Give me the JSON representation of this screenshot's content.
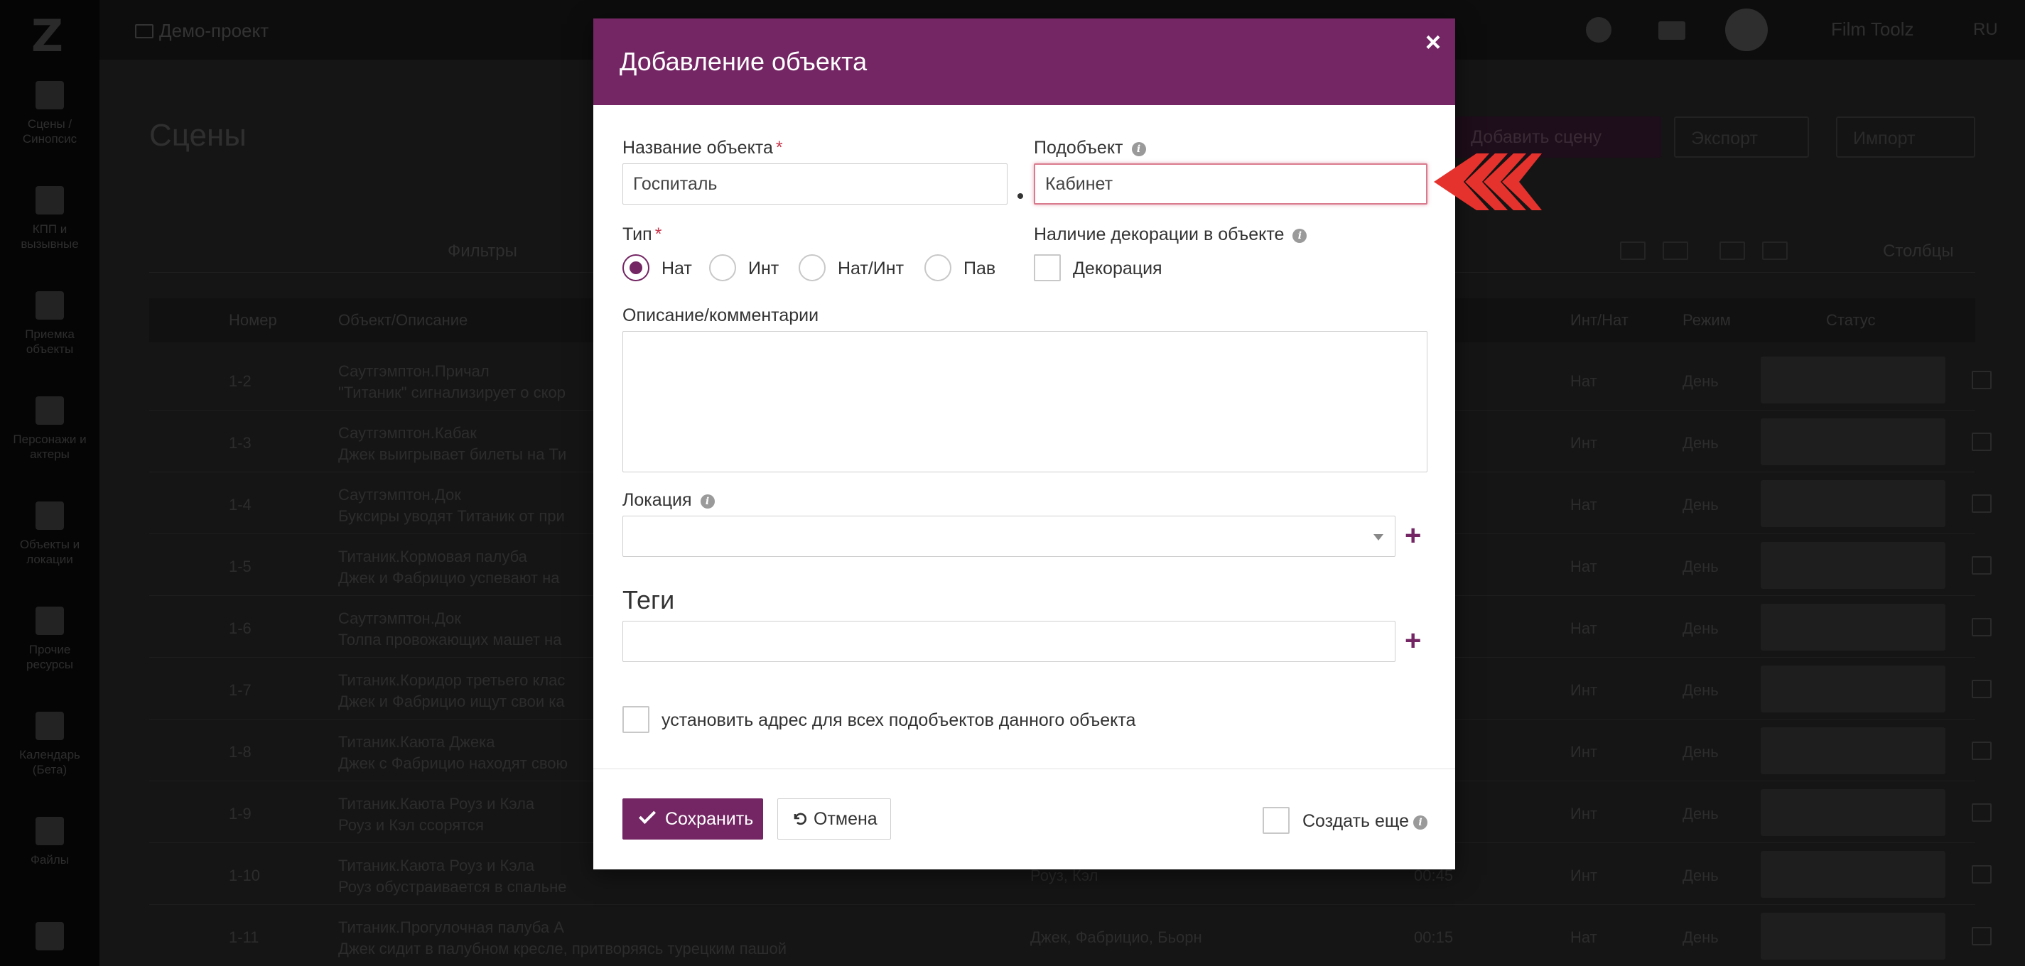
{
  "app": {
    "logo": "Z",
    "project": "Демо-проект",
    "user": "Film Toolz",
    "lang": "RU",
    "sidebar": [
      {
        "label1": "Сцены /",
        "label2": "Синопсис"
      },
      {
        "label1": "КПП и",
        "label2": "вызывные"
      },
      {
        "label1": "Приемка объекты",
        "label2": ""
      },
      {
        "label1": "Персонажи и",
        "label2": "актеры"
      },
      {
        "label1": "Объекты и",
        "label2": "локации"
      },
      {
        "label1": "Прочие",
        "label2": "ресурсы"
      },
      {
        "label1": "Календарь",
        "label2": "(Бета)"
      },
      {
        "label1": "Файлы",
        "label2": ""
      }
    ],
    "page_title": "Сцены",
    "add_scene": "Добавить сцену",
    "export": "Экспорт",
    "import": "Импорт",
    "filters": "Фильтры",
    "columns": "Столбцы",
    "table_headers": {
      "number": "Номер",
      "object": "Объект/Описание",
      "intnat": "Инт/Нат",
      "mode": "Режим",
      "status": "Статус"
    },
    "rows": [
      {
        "num": "1-2",
        "obj": "Саутгэмптон.Причал",
        "desc": "\"Титаник\" сигнализирует о скор",
        "chars": "",
        "dur": "",
        "ie": "Нат",
        "mode": "День"
      },
      {
        "num": "1-3",
        "obj": "Саутгэмптон.Кабак",
        "desc": "Джек выигрывает билеты на Ти",
        "chars": "",
        "dur": "",
        "ie": "Инт",
        "mode": "День"
      },
      {
        "num": "1-4",
        "obj": "Саутгэмптон.Док",
        "desc": "Буксиры уводят Титаник от при",
        "chars": "",
        "dur": "",
        "ie": "Нат",
        "mode": "День"
      },
      {
        "num": "1-5",
        "obj": "Титаник.Кормовая палуба",
        "desc": "Джек и Фабрицио успевают на",
        "chars": "",
        "dur": "",
        "ie": "Нат",
        "mode": "День"
      },
      {
        "num": "1-6",
        "obj": "Саутгэмптон.Док",
        "desc": "Толпа провожающих машет на",
        "chars": "",
        "dur": "",
        "ie": "Нат",
        "mode": "День"
      },
      {
        "num": "1-7",
        "obj": "Титаник.Коридор третьего клас",
        "desc": "Джек и Фабрицио ищут свои ка",
        "chars": "",
        "dur": "",
        "ie": "Инт",
        "mode": "День"
      },
      {
        "num": "1-8",
        "obj": "Титаник.Каюта Джека",
        "desc": "Джек с Фабрицио находят свою",
        "chars": "",
        "dur": "",
        "ie": "Инт",
        "mode": "День"
      },
      {
        "num": "1-9",
        "obj": "Титаник.Каюта Роуз и Кэла",
        "desc": "Роуз и Кэл ссорятся",
        "chars": "",
        "dur": "",
        "ie": "Инт",
        "mode": "День"
      },
      {
        "num": "1-10",
        "obj": "Титаник.Каюта Роуз и Кэла",
        "desc": "Роуз обустраивается в спальне",
        "chars": "Роуз, Кэл",
        "dur": "00:45",
        "ie": "Инт",
        "mode": "День"
      },
      {
        "num": "1-11",
        "obj": "Титаник.Прогулочная палуба А",
        "desc": "Джек сидит в палубном кресле, притворяясь турецким пашой",
        "chars": "Джек, Фабрицио, Бьорн",
        "dur": "00:15",
        "ie": "Нат",
        "mode": "День"
      }
    ]
  },
  "modal": {
    "title": "Добавление объекта",
    "close": "×",
    "object_name_label": "Название объекта",
    "required_mark": "*",
    "object_name_value": "Госпиталь",
    "subobject_label": "Подобъект",
    "subobject_value": "Кабинет",
    "type_label": "Тип",
    "type_options": [
      "Нат",
      "Инт",
      "Нат/Инт",
      "Пав"
    ],
    "type_selected": "Нат",
    "decor_label": "Наличие декорации в объекте",
    "decor_checkbox_label": "Декорация",
    "description_label": "Описание/комментарии",
    "location_label": "Локация",
    "tags_title": "Теги",
    "address_all_label": "установить адрес для всех подобъектов данного объекта",
    "save_label": "Сохранить",
    "cancel_label": "Отмена",
    "create_more_label": "Создать еще",
    "info_glyph": "i",
    "plus_glyph": "+"
  },
  "colors": {
    "accent": "#732663",
    "required": "#c8364b",
    "arrow": "#e5322d"
  }
}
